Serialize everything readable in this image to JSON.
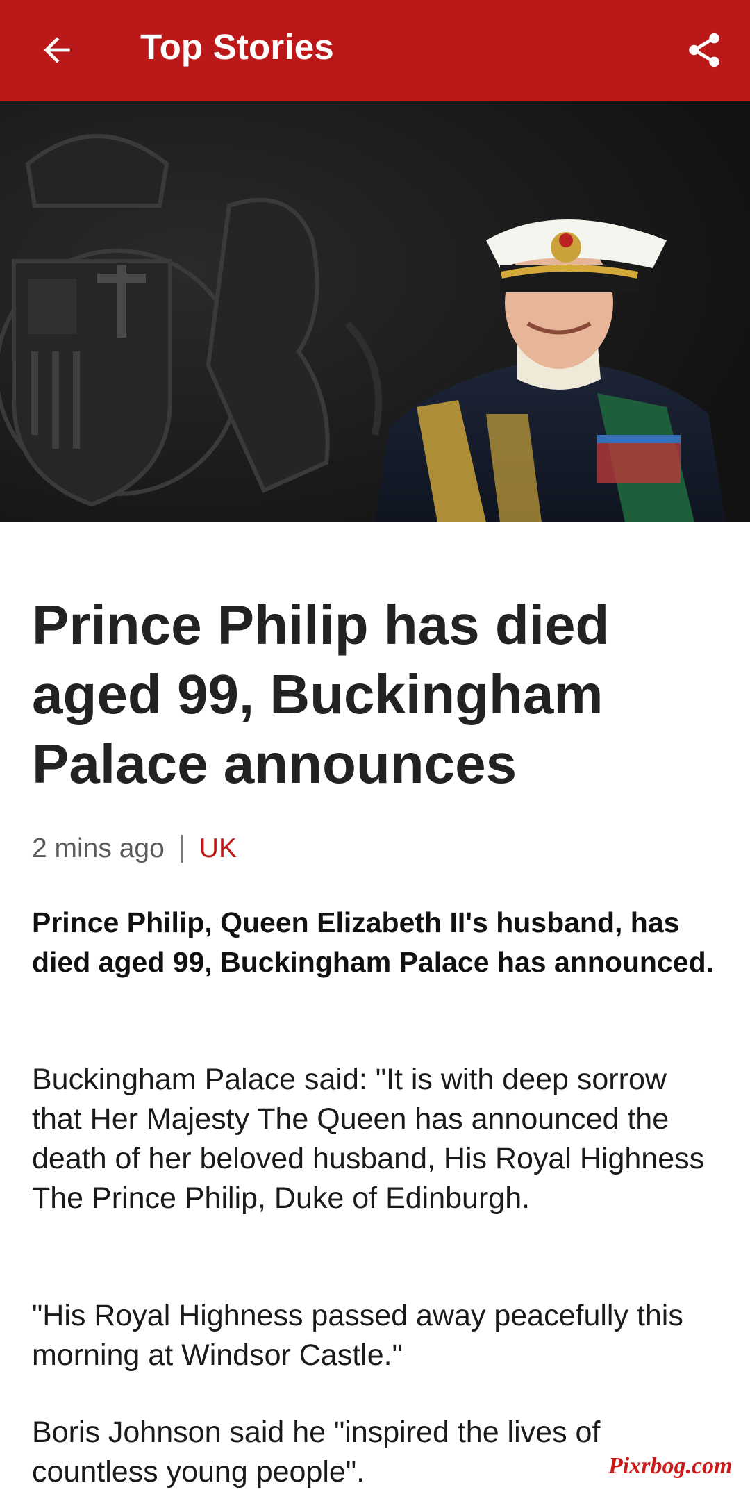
{
  "appbar": {
    "title": "Top Stories",
    "back_icon": "arrow-back-icon",
    "share_icon": "share-icon",
    "color": "#bb1919"
  },
  "hero": {
    "image": "photo of Prince Philip in naval uniform beside royal coat of arms"
  },
  "article": {
    "headline": "Prince Philip has died aged 99, Buckingham Palace announces",
    "time": "2 mins ago",
    "category": "UK",
    "lead": "Prince Philip, Queen Elizabeth II's husband, has died aged 99, Buckingham Palace has announced.",
    "paragraphs": [
      "Buckingham Palace said: \"It is with deep sorrow that Her Majesty The Queen has announced the death of her beloved husband, His Royal Highness The Prince Philip, Duke of Edinburgh.",
      "\"His Royal Highness passed away peacefully this morning at Windsor Castle.\"",
      "Boris Johnson said he \"inspired the lives of countless young people\"."
    ]
  },
  "watermark": "Pixrbog.com"
}
